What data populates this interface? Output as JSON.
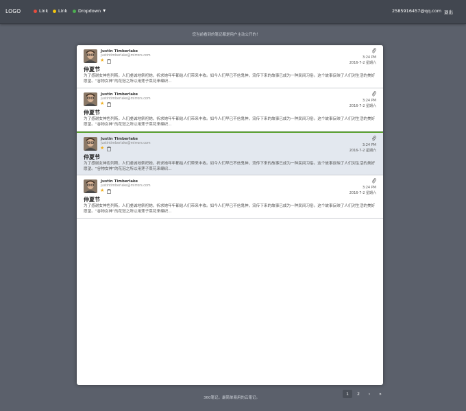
{
  "nav": {
    "logo": "LOGO",
    "links": [
      {
        "label": "Link",
        "color": "#e84c3d"
      },
      {
        "label": "Link",
        "color": "#f1c40f"
      },
      {
        "label": "Dropdown",
        "color": "#4caf50"
      }
    ],
    "user_email": "2585916457@qq.com",
    "logout": "退出"
  },
  "notice": "您当前看到的笔记都是用户主动公开的！",
  "notes": [
    {
      "author": "Justin Timberlake",
      "email": "justintimberlake@mirrors.com",
      "time": "3:24 PM",
      "date": "2016-7-2 星期六",
      "title": "仲夏节",
      "body": "为了感谢女神色列斯，人们虔诚地祭祀她，祈求她年年都给人们带来丰收。如今人们早已不信鬼神，流传下来的故事已成为一种民间习俗。这个故事反映了人们对生活的美好愿望。“谷物女神”的花冠之所以用莲子菜花来编织...",
      "active": false
    },
    {
      "author": "Justin Timberlake",
      "email": "justintimberlake@mirrors.com",
      "time": "3:24 PM",
      "date": "2016-7-2 星期六",
      "title": "仲夏节",
      "body": "为了感谢女神色列斯，人们虔诚地祭祀她，祈求她年年都给人们带来丰收。如今人们早已不信鬼神，流传下来的故事已成为一种民间习俗。这个故事反映了人们对生活的美好愿望。“谷物女神”的花冠之所以用莲子菜花来编织...",
      "active": false
    },
    {
      "author": "Justin Timberlake",
      "email": "justintimberlake@mirrors.com",
      "time": "3:24 PM",
      "date": "2016-7-2 星期六",
      "title": "仲夏节",
      "body": "为了感谢女神色列斯，人们虔诚地祭祀她，祈求她年年都给人们带来丰收。如今人们早已不信鬼神，流传下来的故事已成为一种民间习俗。这个故事反映了人们对生活的美好愿望。“谷物女神”的花冠之所以用莲子菜花来编织...",
      "active": true
    },
    {
      "author": "Justin Timberlake",
      "email": "justintimberlake@mirrors.com",
      "time": "3:24 PM",
      "date": "2016-7-2 星期六",
      "title": "仲夏节",
      "body": "为了感谢女神色列斯，人们虔诚地祭祀她，祈求她年年都给人们带来丰收。如今人们早已不信鬼神，流传下来的故事已成为一种民间习俗。这个故事反映了人们对生活的美好愿望。“谷物女神”的花冠之所以用莲子菜花来编织...",
      "active": false
    }
  ],
  "footer": {
    "summary": "360笔记，最简单易用的云笔记。"
  },
  "pagination": {
    "pages": [
      "1",
      "2"
    ],
    "current": "1",
    "next": "›",
    "last": "»"
  },
  "colors": {
    "accent_green": "#5ea434",
    "star": "#f0ad17"
  }
}
